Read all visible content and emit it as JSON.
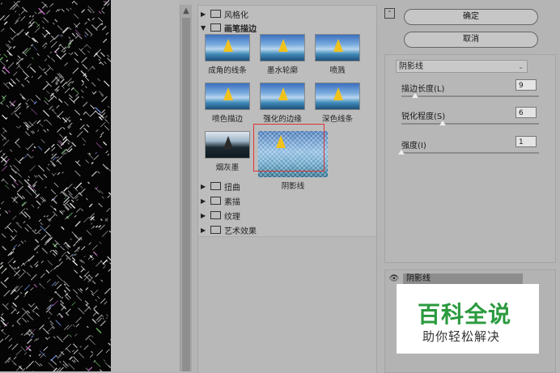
{
  "gallery": {
    "categories_top": [
      {
        "label": "风格化",
        "open": false
      },
      {
        "label": "画笔描边",
        "open": true
      }
    ],
    "thumbs": [
      {
        "label": "成角的线条"
      },
      {
        "label": "墨水轮廓"
      },
      {
        "label": "喷溅"
      },
      {
        "label": "喷色描边"
      },
      {
        "label": "强化的边缘"
      },
      {
        "label": "深色线条"
      },
      {
        "label": "烟灰墨"
      },
      {
        "label": "阴影线",
        "selected": true
      }
    ],
    "categories_bottom": [
      {
        "label": "扭曲"
      },
      {
        "label": "素描"
      },
      {
        "label": "纹理"
      },
      {
        "label": "艺术效果"
      }
    ]
  },
  "actions": {
    "ok_label": "确定",
    "cancel_label": "取消",
    "collapse_icon": "collapse-icon"
  },
  "settings": {
    "filter_select": "阴影线",
    "params": [
      {
        "label": "描边长度(L)",
        "value": "9",
        "level": 0.1
      },
      {
        "label": "锐化程度(S)",
        "value": "6",
        "level": 0.3
      },
      {
        "label": "强度(I)",
        "value": "1",
        "level": 0.0
      }
    ]
  },
  "layers": {
    "active_layer": "阴影线"
  },
  "watermark": {
    "title": "百科全说",
    "subtitle": "助你轻松解决"
  },
  "colors": {
    "selection_border": "#dd3333",
    "watermark_green": "#2a9a3e"
  }
}
